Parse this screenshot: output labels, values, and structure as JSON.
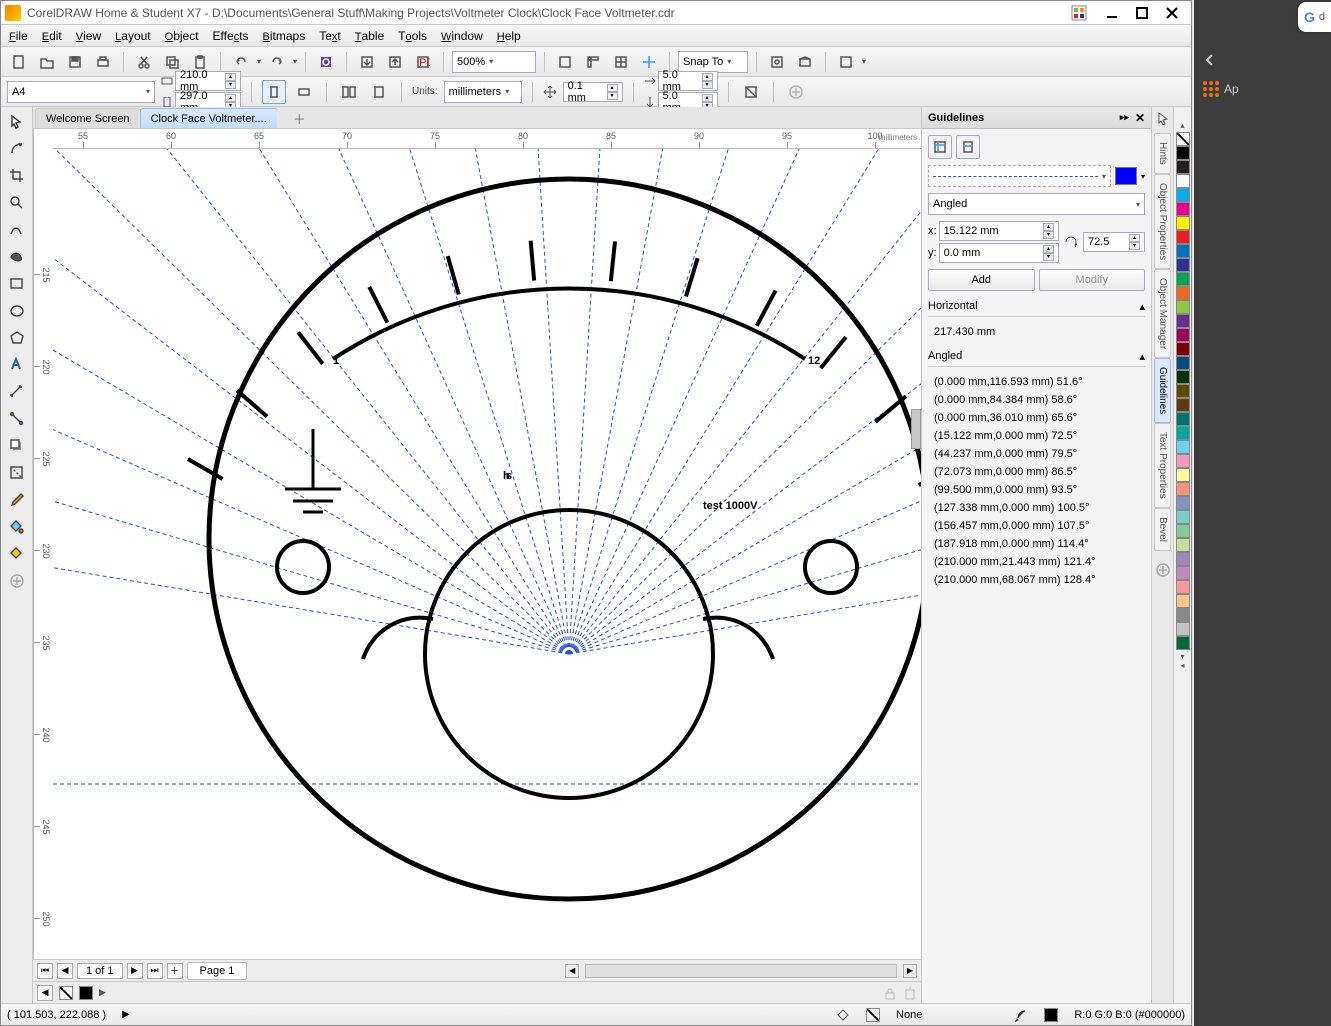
{
  "title": "CorelDRAW Home & Student X7 - D:\\Documents\\General Stuff\\Making Projects\\Voltmeter Clock\\Clock Face Voltmeter.cdr",
  "menu": [
    "File",
    "Edit",
    "View",
    "Layout",
    "Object",
    "Effects",
    "Bitmaps",
    "Text",
    "Table",
    "Tools",
    "Window",
    "Help"
  ],
  "zoom": "500%",
  "snap": "Snap To",
  "prop": {
    "paper": "A4",
    "w": "210.0 mm",
    "h": "297.0 mm",
    "units_label": "Units:",
    "units": "millimeters",
    "nudge": "0.1 mm",
    "dupx": "5.0 mm",
    "dupy": "5.0 mm"
  },
  "tabs": {
    "welcome": "Welcome Screen",
    "file": "Clock Face Voltmeter...."
  },
  "ruler": {
    "unit": "millimeters",
    "h": [
      "55",
      "60",
      "65",
      "70",
      "75",
      "80",
      "85",
      "90",
      "95",
      "100"
    ],
    "v": [
      "250",
      "245",
      "240",
      "235",
      "230",
      "225",
      "220",
      "215"
    ]
  },
  "art": {
    "n1": "1",
    "n12": "12",
    "hrs": "hrs",
    "test": "test 1000V"
  },
  "docker": {
    "title": "Guidelines",
    "type": "Angled",
    "x_label": "x:",
    "x_val": "15.122 mm",
    "y_label": "y:",
    "y_val": "0.0 mm",
    "angle": "72.5",
    "add": "Add",
    "modify": "Modify",
    "hsect": "Horizontal",
    "hval": "217.430 mm",
    "asect": "Angled",
    "ang": [
      "(0.000 mm,116.593 mm) 51.6°",
      "(0.000 mm,84.384 mm) 58.6°",
      "(0.000 mm,36.010 mm) 65.6°",
      "(15.122 mm,0.000 mm) 72.5°",
      "(44.237 mm,0.000 mm) 79.5°",
      "(72.073 mm,0.000 mm) 86.5°",
      "(99.500 mm,0.000 mm) 93.5°",
      "(127.338 mm,0.000 mm) 100.5°",
      "(156.457 mm,0.000 mm) 107.5°",
      "(187.918 mm,0.000 mm) 114.4°",
      "(210.000 mm,21.443 mm) 121.4°",
      "(210.000 mm,68.067 mm) 128.4°"
    ],
    "guideline_color": "#0000ff"
  },
  "docktabs": [
    "Hints",
    "Object Properties",
    "Object Manager",
    "Guidelines",
    "Text Properties",
    "Bevel"
  ],
  "palette": [
    "#000000",
    "#221e1f",
    "#ffffff",
    "#00aeef",
    "#ec008c",
    "#fff200",
    "#ed1c24",
    "#0072bc",
    "#2e3192",
    "#00a651",
    "#f26522",
    "#8dc63f",
    "#662d91",
    "#9e005d",
    "#790000",
    "#004a80",
    "#003300",
    "#5b4a00",
    "#603913",
    "#00746b",
    "#00a99d",
    "#6dcff6",
    "#f49ac1",
    "#fff799",
    "#f69679",
    "#8393ca",
    "#7accc8",
    "#82ca9c",
    "#c4df9b",
    "#a186be",
    "#bd8cbf",
    "#f5989d",
    "#fdc689",
    "#898989",
    "#c2c2c2",
    "#006838"
  ],
  "page": {
    "count": "1 of 1",
    "tab": "Page 1"
  },
  "status": {
    "coord": "( 101.503, 222.088 )",
    "fill_label": "None",
    "color_label": "R:0 G:0 B:0 (#000000)"
  },
  "browser": {
    "g": "G",
    "txt": "d",
    "ap": "Ap"
  }
}
